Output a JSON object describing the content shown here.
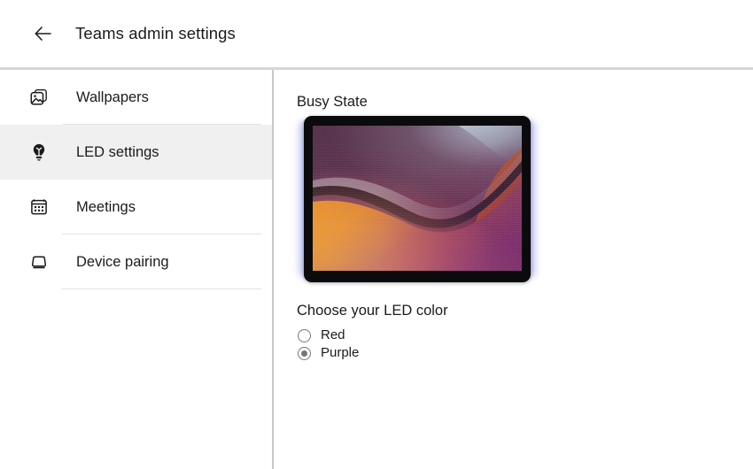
{
  "header": {
    "back_icon": "arrow-left-icon",
    "title": "Teams admin settings"
  },
  "sidebar": {
    "items": [
      {
        "label": "Wallpapers",
        "icon": "image-stack-icon",
        "selected": false
      },
      {
        "label": "LED settings",
        "icon": "lightbulb-icon",
        "selected": true
      },
      {
        "label": "Meetings",
        "icon": "calendar-icon",
        "selected": false
      },
      {
        "label": "Device pairing",
        "icon": "monitor-icon",
        "selected": false
      }
    ]
  },
  "main": {
    "section_title": "Busy State",
    "preview": {
      "device_name": "tablet-preview",
      "wallpaper_name": "abstract-purple-orange-wave",
      "led_glow_color": "#a9afF2",
      "bezel_color": "#0b0b0d"
    },
    "chooser": {
      "title": "Choose your LED color",
      "options": [
        {
          "label": "Red",
          "selected": false,
          "value": "red"
        },
        {
          "label": "Purple",
          "selected": true,
          "value": "purple"
        }
      ]
    }
  },
  "colors": {
    "page_background": "#ffffff",
    "text_primary": "#1b1b1b",
    "divider": "#d6d6d6",
    "sidebar_divider": "#c9c9c9",
    "selected_row": "#f0f0f0",
    "separator": "#e3e3e3",
    "radio_accent": "#767676"
  }
}
